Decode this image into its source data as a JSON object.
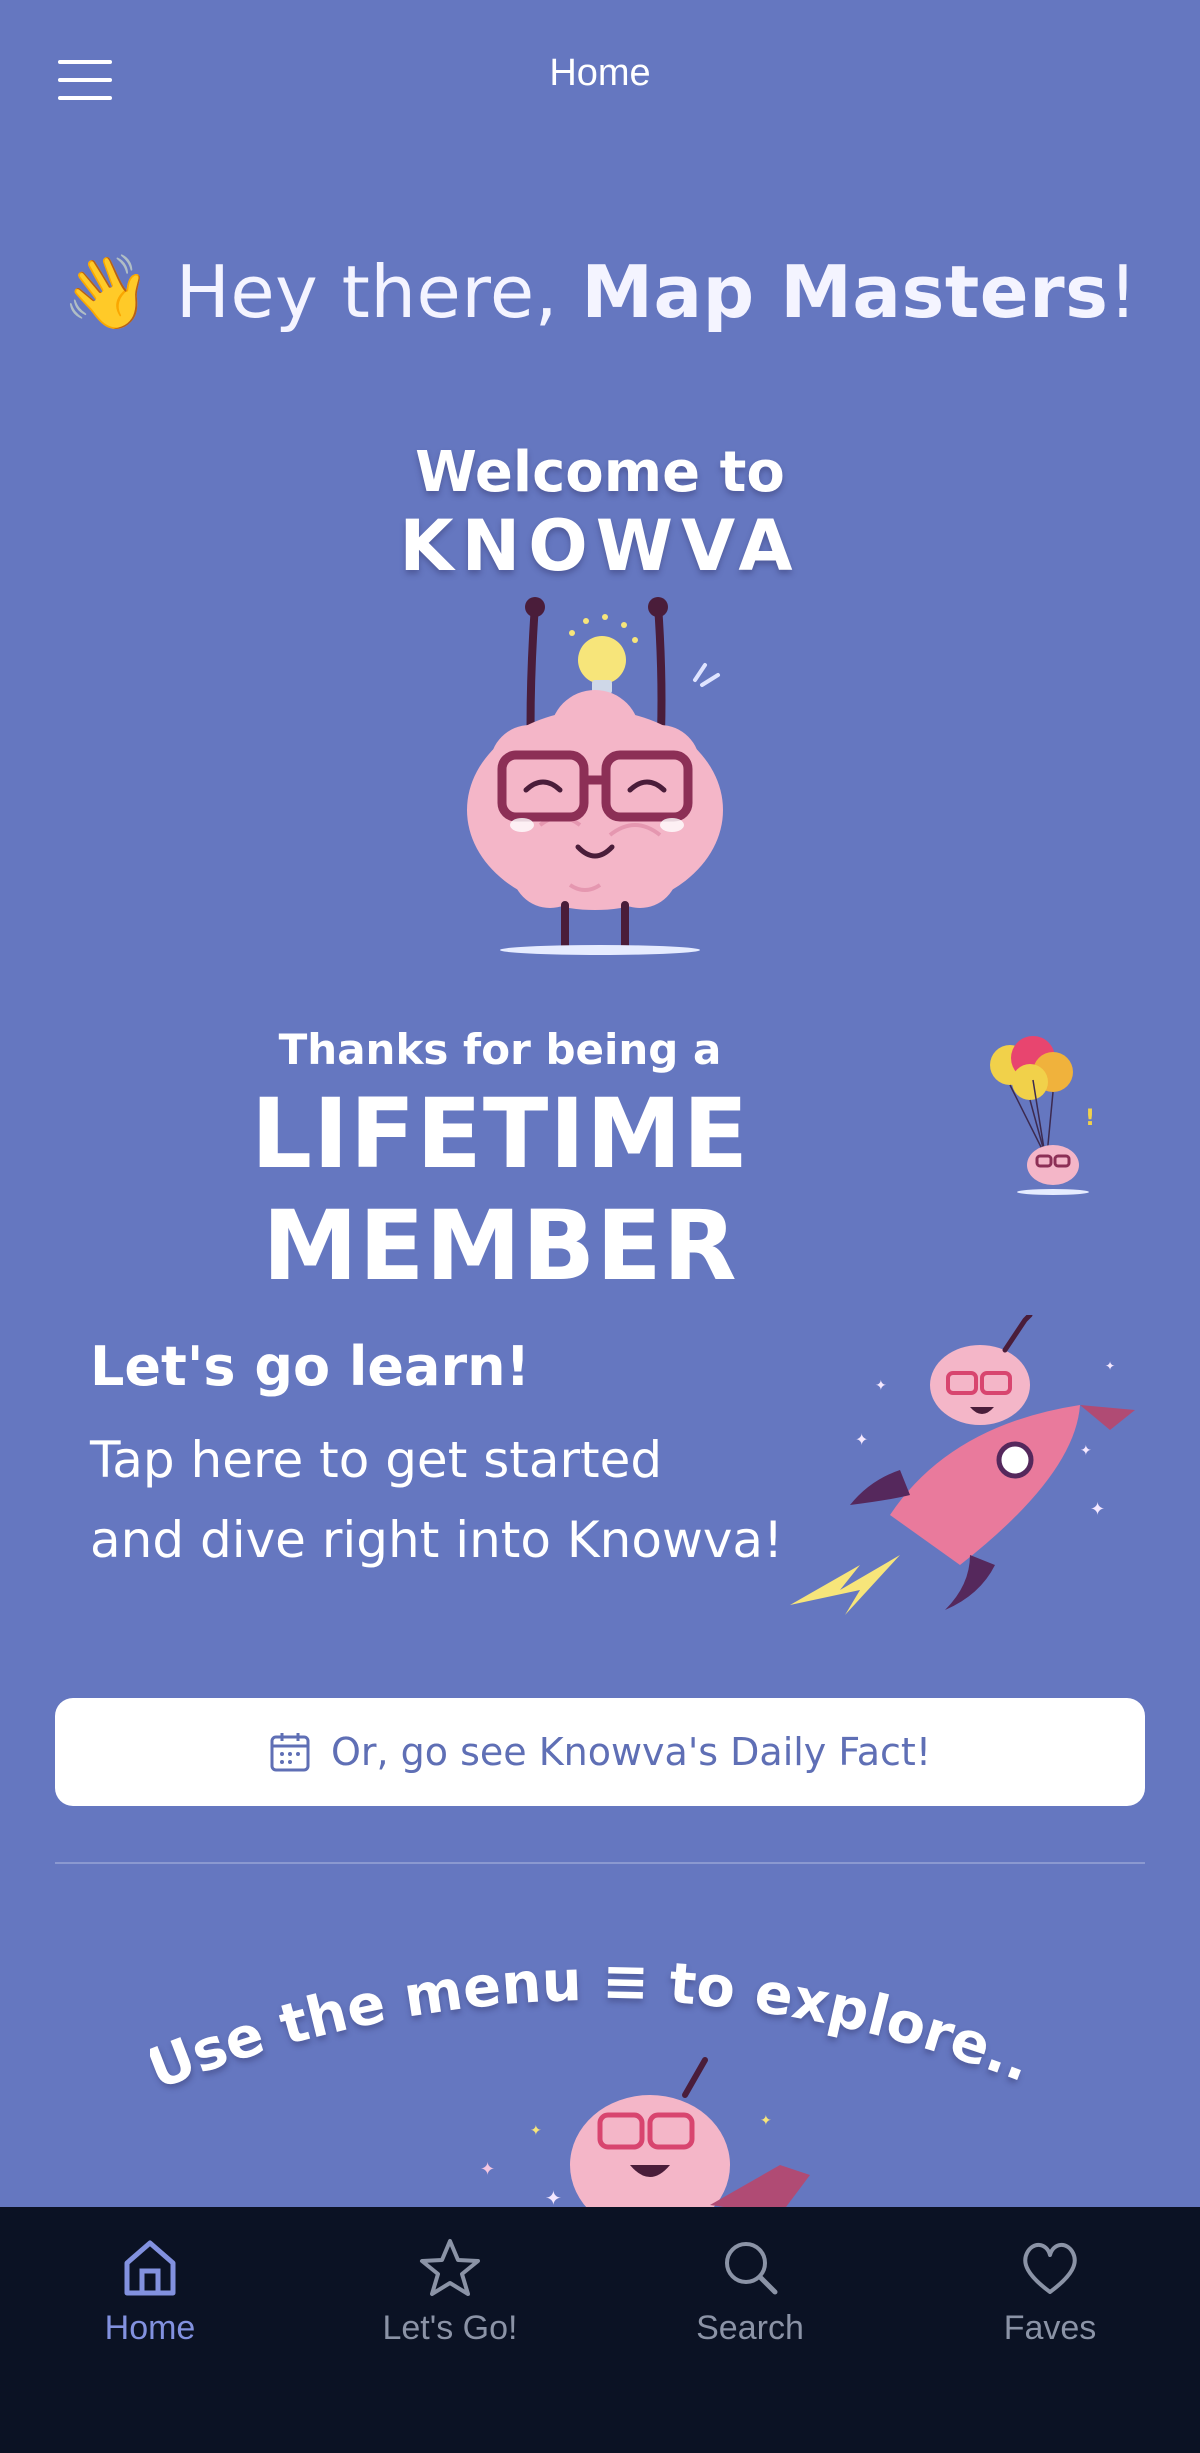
{
  "header": {
    "title": "Home",
    "menu_icon": "hamburger-icon"
  },
  "greeting": {
    "wave": "👋",
    "prefix": "Hey there,",
    "name": "Map Masters",
    "suffix": "!"
  },
  "welcome": {
    "line1": "Welcome to",
    "line2": "KNOWVA"
  },
  "membership": {
    "line1": "Thanks for being a",
    "line2": "LIFETIME MEMBER"
  },
  "learn": {
    "title": "Let's go learn!",
    "line1": "Tap here to get started",
    "line2": "and dive right into Knowva!"
  },
  "daily_fact": {
    "label": "Or, go see Knowva's Daily Fact!",
    "icon": "calendar-icon"
  },
  "explore": {
    "text": "Use the menu ≡ to explore..."
  },
  "tabs": [
    {
      "label": "Home",
      "icon": "home-icon",
      "active": true
    },
    {
      "label": "Let's Go!",
      "icon": "star-icon",
      "active": false
    },
    {
      "label": "Search",
      "icon": "search-icon",
      "active": false
    },
    {
      "label": "Faves",
      "icon": "heart-icon",
      "active": false
    }
  ],
  "colors": {
    "background": "#6577c0",
    "tabbar": "#0b1224",
    "active_tab": "#8291df",
    "inactive_tab": "#8b93a6",
    "button_text": "#5f6fb5",
    "brain_pink": "#f4b6c8",
    "glasses": "#8c2f56"
  }
}
